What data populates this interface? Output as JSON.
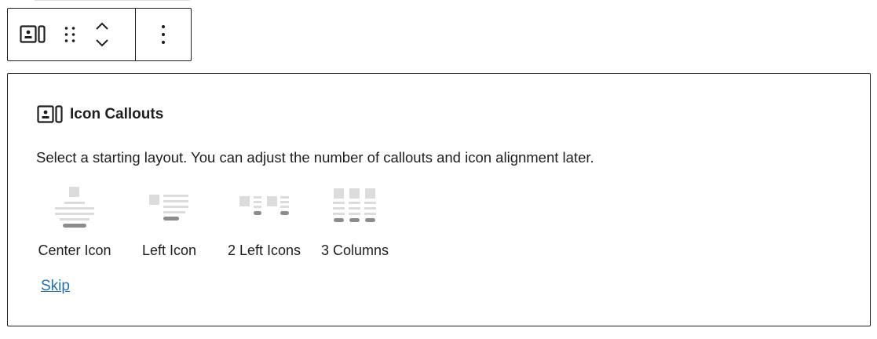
{
  "toolbar": {
    "block_icon": "icon-callouts-block-icon",
    "drag_icon": "drag-handle-icon",
    "move_up_icon": "chevron-up-icon",
    "move_down_icon": "chevron-down-icon",
    "more_icon": "more-vertical-icon"
  },
  "placeholder": {
    "title": "Icon Callouts",
    "title_icon": "icon-callouts-block-icon",
    "instructions": "Select a starting layout. You can adjust the number of callouts and icon alignment later.",
    "layouts": [
      {
        "label": "Center Icon",
        "icon": "center-icon-layout-icon"
      },
      {
        "label": "Left Icon",
        "icon": "left-icon-layout-icon"
      },
      {
        "label": "2 Left Icons",
        "icon": "two-left-icons-layout-icon"
      },
      {
        "label": "3 Columns",
        "icon": "three-columns-layout-icon"
      }
    ],
    "skip_label": "Skip"
  },
  "colors": {
    "text": "#1e1e1e",
    "border": "#1e1e1e",
    "preview_light": "#dcdcdc",
    "preview_mid": "#bdbdbd",
    "preview_dark": "#8c8c8c",
    "link": "#2271b1"
  }
}
